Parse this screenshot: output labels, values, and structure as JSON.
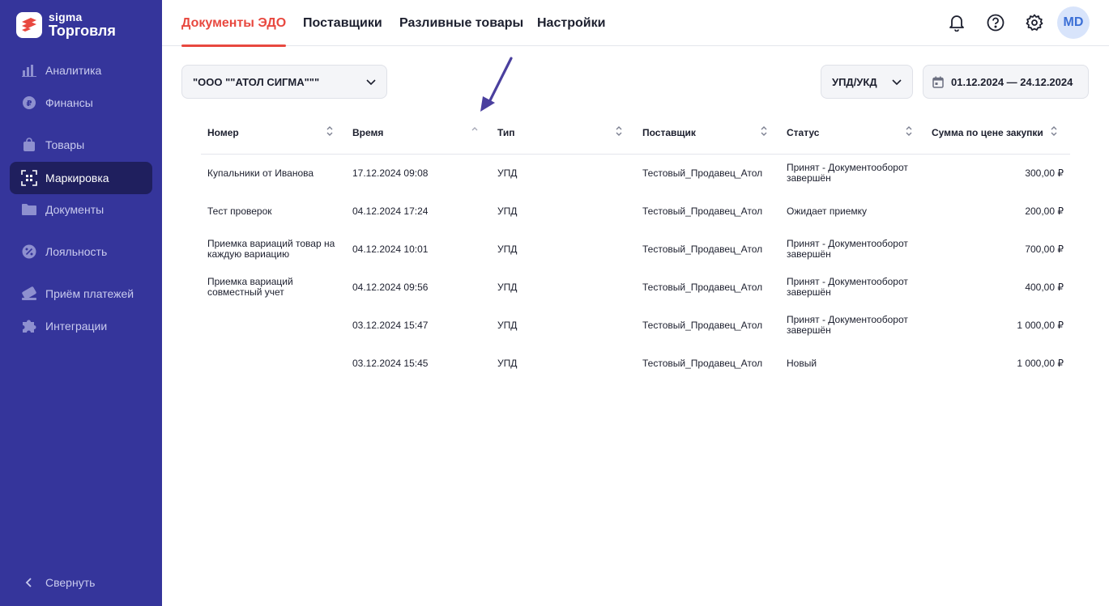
{
  "sidebar": {
    "logo_small": "sigma",
    "logo_big": "Торговля",
    "items": [
      {
        "label": "Аналитика",
        "icon": "chart-bars-icon"
      },
      {
        "label": "Финансы",
        "icon": "ruble-coin-icon"
      },
      {
        "label": "Товары",
        "icon": "shopping-bag-icon"
      },
      {
        "label": "Маркировка",
        "icon": "barcode-scan-icon"
      },
      {
        "label": "Документы",
        "icon": "folder-icon"
      },
      {
        "label": "Лояльность",
        "icon": "discount-badge-icon"
      },
      {
        "label": "Приём платежей",
        "icon": "payment-card-icon"
      },
      {
        "label": "Интеграции",
        "icon": "puzzle-icon"
      }
    ],
    "active_item": "Маркировка",
    "collapse_label": "Свернуть"
  },
  "topbar": {
    "tabs": [
      {
        "label": "Документы ЭДО",
        "active": true
      },
      {
        "label": "Поставщики",
        "active": false
      },
      {
        "label": "Разливные товары",
        "active": false
      },
      {
        "label": "Настройки",
        "active": false
      }
    ],
    "icons": [
      "bell-icon",
      "help-icon",
      "settings-gear-icon"
    ],
    "avatar_initials": "MD"
  },
  "filters": {
    "organization": "\"ООО \"\"АТОЛ СИГМА\"\"\"",
    "doc_type": "УПД/УКД",
    "date_range": "01.12.2024 — 24.12.2024"
  },
  "table": {
    "columns": [
      "Номер",
      "Время",
      "Тип",
      "Поставщик",
      "Статус",
      "Сумма по цене закупки"
    ],
    "sorted_column": "Время",
    "rows": [
      {
        "number": "Купальники от Иванова",
        "time": "17.12.2024 09:08",
        "type": "УПД",
        "supplier": "Тестовый_Продавец_Атол",
        "status": "Принят - Документооборот завершён",
        "amount": "300,00 ₽"
      },
      {
        "number": "Тест проверок",
        "time": "04.12.2024 17:24",
        "type": "УПД",
        "supplier": "Тестовый_Продавец_Атол",
        "status": "Ожидает приемку",
        "amount": "200,00 ₽"
      },
      {
        "number": "Приемка вариаций товар на каждую вариацию",
        "time": "04.12.2024 10:01",
        "type": "УПД",
        "supplier": "Тестовый_Продавец_Атол",
        "status": "Принят - Документооборот завершён",
        "amount": "700,00 ₽"
      },
      {
        "number": "Приемка вариаций совместный учет",
        "time": "04.12.2024 09:56",
        "type": "УПД",
        "supplier": "Тестовый_Продавец_Атол",
        "status": "Принят - Документооборот завершён",
        "amount": "400,00 ₽"
      },
      {
        "number": "",
        "time": "03.12.2024 15:47",
        "type": "УПД",
        "supplier": "Тестовый_Продавец_Атол",
        "status": "Принят - Документооборот завершён",
        "amount": "1 000,00 ₽"
      },
      {
        "number": "",
        "time": "03.12.2024 15:45",
        "type": "УПД",
        "supplier": "Тестовый_Продавец_Атол",
        "status": "Новый",
        "amount": "1 000,00 ₽"
      }
    ]
  },
  "colors": {
    "sidebar_bg": "#35359b",
    "sidebar_active_bg": "#1f1f5e",
    "accent_red": "#e8483f",
    "annotation_arrow": "#4a3f9e"
  }
}
